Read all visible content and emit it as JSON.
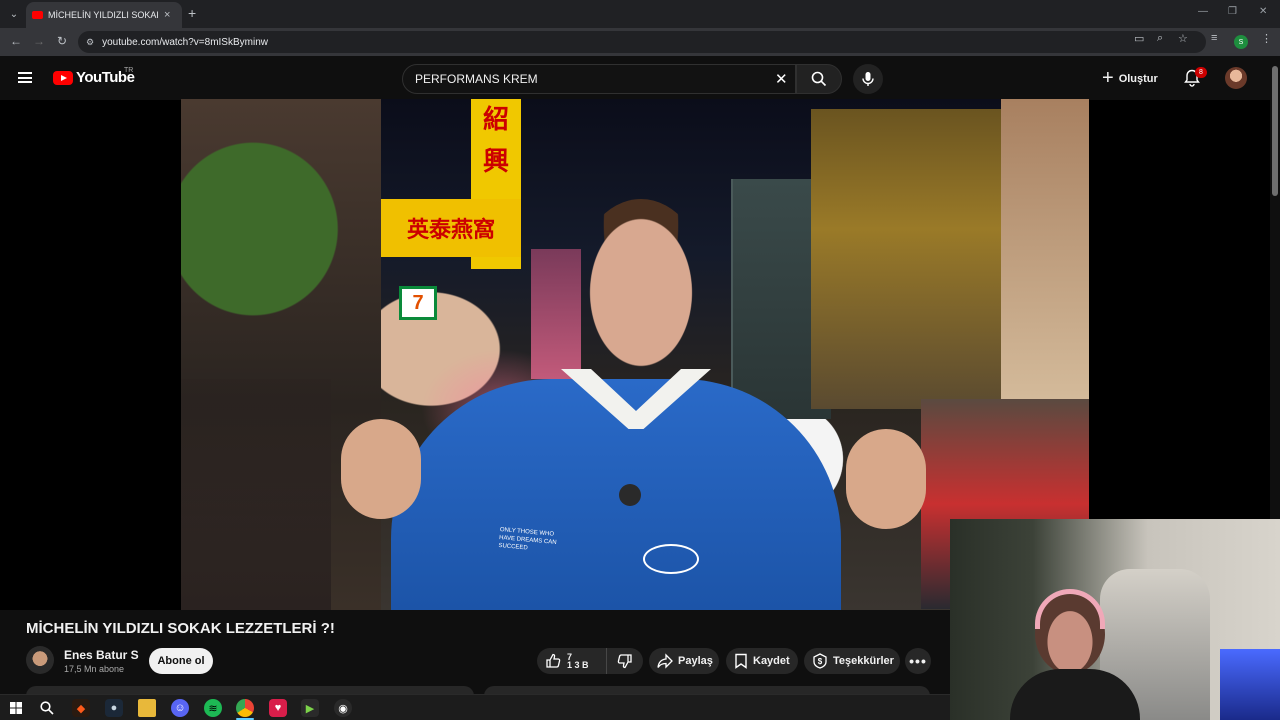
{
  "browser": {
    "tab_title": "MİCHELİN YILDIZLI SOKAK LEZZ",
    "tab_close": "×",
    "new_tab": "+",
    "url": "youtube.com/watch?v=8mISkByminw",
    "profile_initial": "S",
    "window_controls": [
      "—",
      "❐",
      "✕"
    ]
  },
  "youtube": {
    "logo_text": "YouTube",
    "country_code": "TR",
    "search_value": "PERFORMANS KREM",
    "create_label": "Oluştur",
    "notification_count": "8"
  },
  "video": {
    "title": "MİCHELİN YILDIZLI SOKAK LEZZETLERİ ?!",
    "shirt_text": "ONLY THOSE WHO HAVE DREAMS CAN SUCCEED",
    "signs": [
      "紹",
      "興",
      "英泰燕窩",
      "7"
    ]
  },
  "channel": {
    "name": "Enes Batur S",
    "subscribers": "17,5 Mn abone",
    "subscribe_label": "Abone ol"
  },
  "actions": {
    "like_count_top": "7",
    "like_count_bottom": "1 3 B",
    "share_label": "Paylaş",
    "save_label": "Kaydet",
    "thanks_label": "Teşekkürler",
    "more_label": "•••"
  },
  "taskbar": {
    "apps": [
      "windows-start",
      "search",
      "brave",
      "steam",
      "file-explorer",
      "discord",
      "spotify",
      "chrome",
      "app-red",
      "app-green",
      "app-obs"
    ]
  },
  "colors": {
    "youtube_red": "#ff0000",
    "background": "#0f0f0f",
    "pill": "#272727"
  }
}
